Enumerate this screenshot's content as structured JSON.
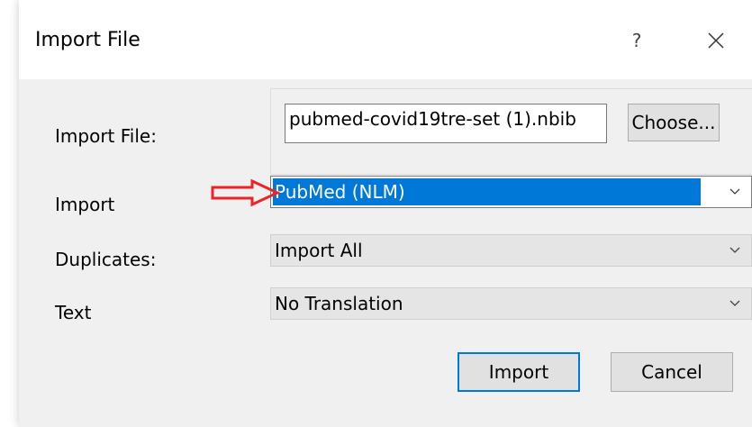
{
  "window": {
    "title": "Import File",
    "help_label": "?"
  },
  "form": {
    "import_file": {
      "label": "Import File:",
      "value": "pubmed-covid19tre-set (1).nbib",
      "choose_label": "Choose..."
    },
    "import_filter": {
      "label": "Import",
      "selected": "PubMed (NLM)"
    },
    "duplicates": {
      "label": "Duplicates:",
      "selected": "Import All"
    },
    "text": {
      "label": "Text",
      "selected": "No Translation"
    }
  },
  "buttons": {
    "import_label": "Import",
    "cancel_label": "Cancel"
  },
  "colors": {
    "accent": "#0078d7",
    "annotation_arrow": "#e8262a"
  }
}
